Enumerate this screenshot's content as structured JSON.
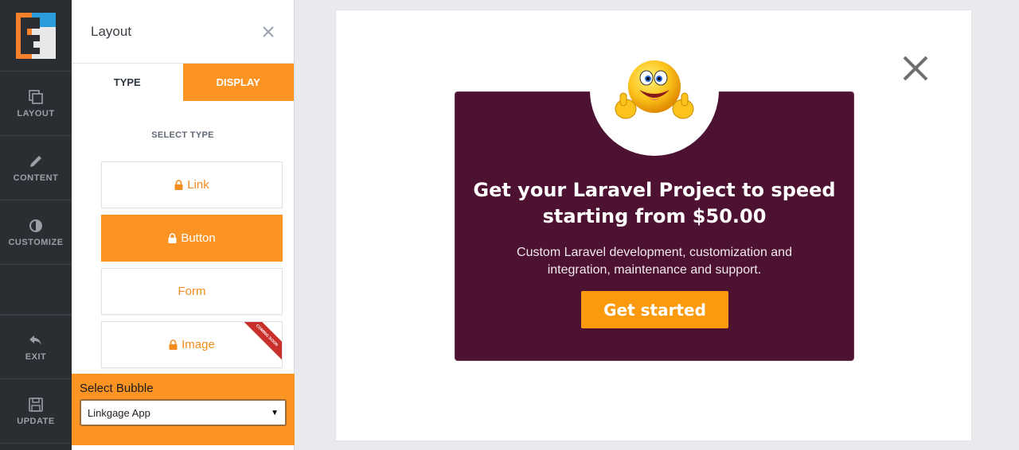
{
  "rail": {
    "items": [
      {
        "label": "LAYOUT",
        "icon": "copy-icon"
      },
      {
        "label": "CONTENT",
        "icon": "pencil-icon"
      },
      {
        "label": "CUSTOMIZE",
        "icon": "contrast-icon"
      }
    ],
    "exit_label": "EXIT",
    "update_label": "UPDATE"
  },
  "panel": {
    "title": "Layout",
    "tabs": [
      {
        "label": "TYPE",
        "active": true
      },
      {
        "label": "DISPLAY",
        "active": false
      }
    ],
    "section_label": "SELECT TYPE",
    "types": [
      {
        "label": "Link",
        "locked": true,
        "selected": false
      },
      {
        "label": "Button",
        "locked": true,
        "selected": true
      },
      {
        "label": "Form",
        "locked": false,
        "selected": false
      },
      {
        "label": "Image",
        "locked": true,
        "selected": false,
        "badge": "COMING SOON"
      }
    ],
    "bubble": {
      "label": "Select Bubble",
      "selected": "Linkgage App"
    }
  },
  "preview": {
    "title_line1": "Get your Laravel Project to speed",
    "title_line2": "starting from $50.00",
    "text_line1": "Custom Laravel development, customization and",
    "text_line2": "integration, maintenance and support.",
    "cta_label": "Get started"
  },
  "colors": {
    "accent": "#fb9422",
    "rail_bg": "#2a2e33",
    "card_bg": "#4d1131",
    "cta": "#fb9a0c"
  }
}
